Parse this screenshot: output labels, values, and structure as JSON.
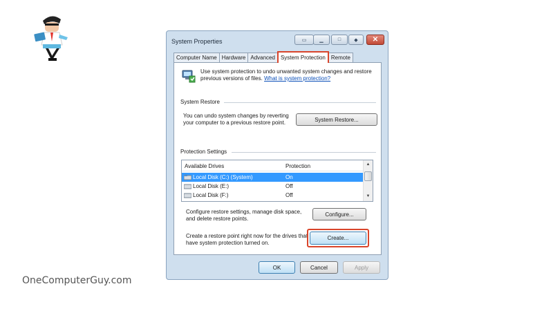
{
  "window": {
    "title": "System Properties",
    "controls": [
      "hidden-1",
      "minimize",
      "maximize",
      "resize",
      "close"
    ],
    "close_glyph": "✕"
  },
  "tabs": [
    {
      "label": "Computer Name",
      "active": false
    },
    {
      "label": "Hardware",
      "active": false
    },
    {
      "label": "Advanced",
      "active": false
    },
    {
      "label": "System Protection",
      "active": true
    },
    {
      "label": "Remote",
      "active": false
    }
  ],
  "intro": {
    "text": "Use system protection to undo unwanted system changes and restore previous versions of files.",
    "link": "What is system protection?"
  },
  "system_restore": {
    "group_title": "System Restore",
    "description": "You can undo system changes by reverting your computer to a previous restore point.",
    "button_label": "System Restore..."
  },
  "protection": {
    "group_title": "Protection Settings",
    "columns": [
      "Available Drives",
      "Protection"
    ],
    "drives": [
      {
        "name": "Local Disk (C:) (System)",
        "protection": "On",
        "selected": true
      },
      {
        "name": "Local Disk (E:)",
        "protection": "Off",
        "selected": false
      },
      {
        "name": "Local Disk (F:)",
        "protection": "Off",
        "selected": false
      }
    ],
    "configure_text": "Configure restore settings, manage disk space, and delete restore points.",
    "configure_button": "Configure...",
    "create_text": "Create a restore point right now for the drives that have system protection turned on.",
    "create_button": "Create..."
  },
  "footer": {
    "ok": "OK",
    "cancel": "Cancel",
    "apply": "Apply"
  },
  "highlight_color": "#d9442a",
  "selection_color": "#3399ff",
  "site_caption": "OneComputerGuy.com"
}
